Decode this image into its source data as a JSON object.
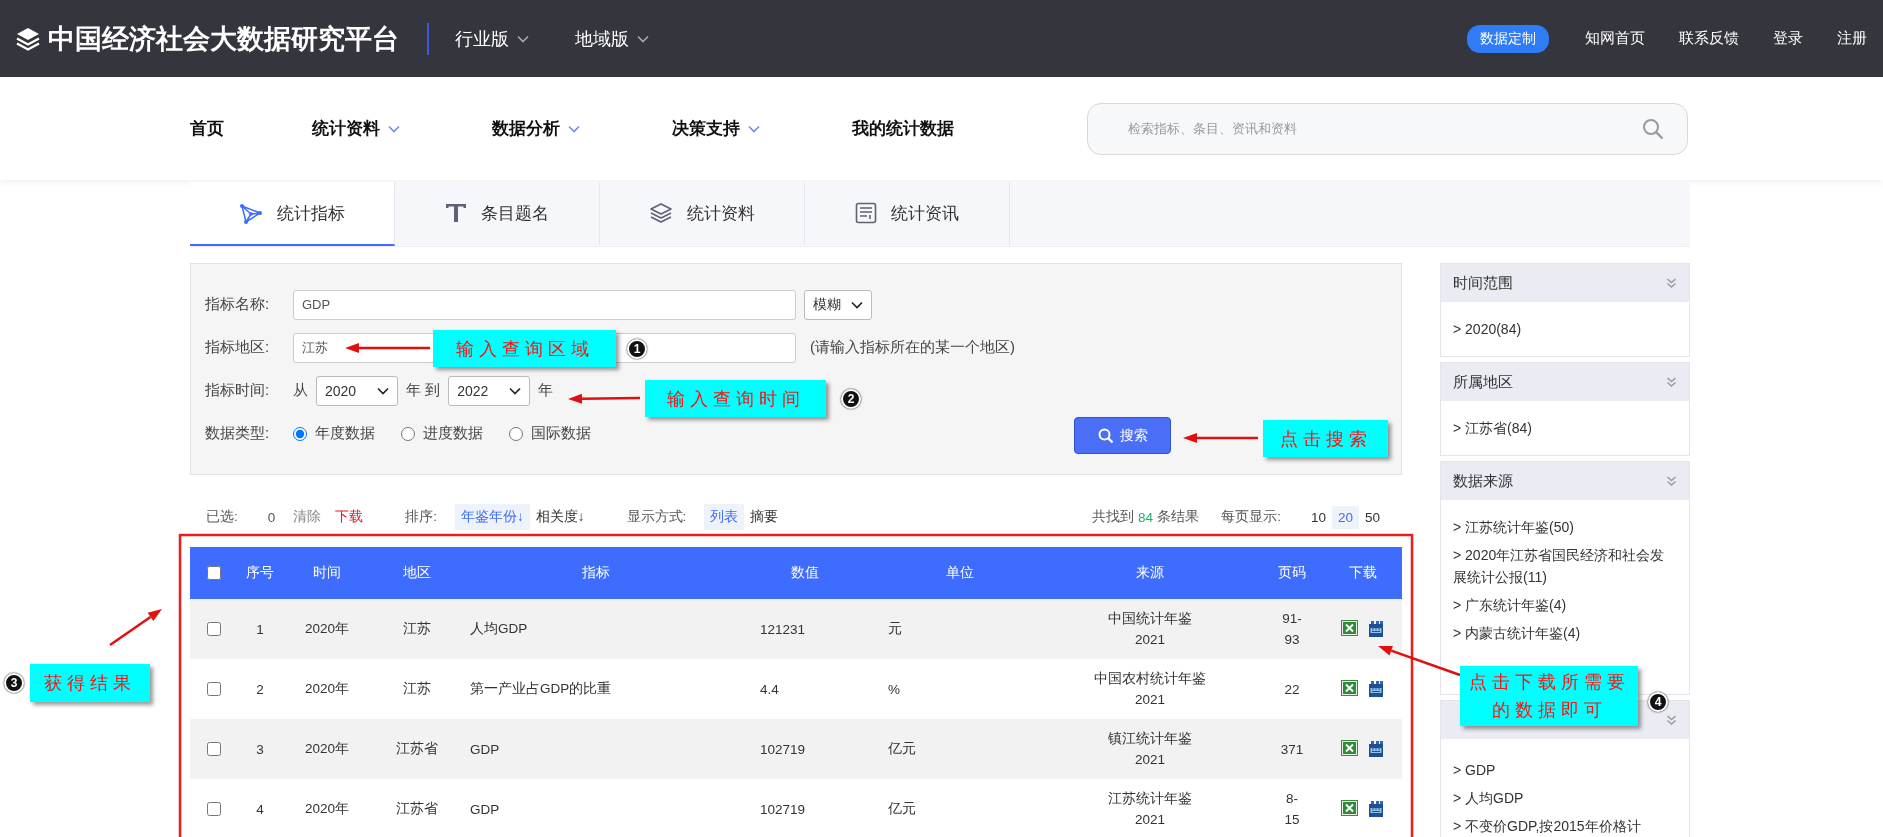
{
  "topbar": {
    "title": "中国经济社会大数据研究平台",
    "editions": [
      "行业版",
      "地域版"
    ],
    "custom_button": "数据定制",
    "links": [
      "知网首页",
      "联系反馈",
      "登录",
      "注册"
    ]
  },
  "nav": {
    "items": [
      {
        "label": "首页",
        "dropdown": false
      },
      {
        "label": "统计资料",
        "dropdown": true
      },
      {
        "label": "数据分析",
        "dropdown": true
      },
      {
        "label": "决策支持",
        "dropdown": true
      },
      {
        "label": "我的统计数据",
        "dropdown": false
      }
    ],
    "search_placeholder": "检索指标、条目、资讯和资料"
  },
  "tabs": [
    {
      "label": "统计指标",
      "kind": "network",
      "selected": true
    },
    {
      "label": "条目题名",
      "kind": "title",
      "selected": false
    },
    {
      "label": "统计资料",
      "kind": "layers",
      "selected": false
    },
    {
      "label": "统计资讯",
      "kind": "news",
      "selected": false
    }
  ],
  "form": {
    "name_label": "指标名称:",
    "name_value": "GDP",
    "match_mode": "模糊",
    "region_label": "指标地区:",
    "region_value": "江苏",
    "region_hint": "(请输入指标所在的某一个地区)",
    "time_label": "指标时间:",
    "from": "从",
    "from_year": "2020",
    "year_to": "年 到",
    "to_year": "2022",
    "year": "年",
    "type_label": "数据类型:",
    "types": [
      {
        "label": "年度数据",
        "selected": true
      },
      {
        "label": "进度数据",
        "selected": false
      },
      {
        "label": "国际数据",
        "selected": false
      }
    ],
    "search_button": "搜索"
  },
  "filter_bar": {
    "selected_label": "已选:",
    "selected_count": "0",
    "clear": "清除",
    "download": "下载",
    "sort_label": "排序:",
    "sort_options": [
      {
        "label": "年鉴年份↓",
        "selected": true
      },
      {
        "label": "相关度↓",
        "selected": false
      }
    ],
    "display_label": "显示方式:",
    "display_options": [
      {
        "label": "列表",
        "selected": true
      },
      {
        "label": "摘要",
        "selected": false
      }
    ],
    "found_prefix": "共找到",
    "found_count": "84",
    "found_suffix": "条结果",
    "per_page_label": "每页显示:",
    "per_page_options": [
      {
        "label": "10",
        "selected": false
      },
      {
        "label": "20",
        "selected": true
      },
      {
        "label": "50",
        "selected": false
      }
    ]
  },
  "table": {
    "header_checked": false,
    "columns": [
      "序号",
      "时间",
      "地区",
      "指标",
      "数值",
      "单位",
      "来源",
      "页码",
      "下载"
    ],
    "rows": [
      {
        "checked": false,
        "no": "1",
        "time": "2020年",
        "region": "江苏",
        "indicator": "人均GDP",
        "value": "121231",
        "unit": "元",
        "source": [
          "中国统计年鉴",
          "2021"
        ],
        "page": [
          "91-",
          "93"
        ]
      },
      {
        "checked": false,
        "no": "2",
        "time": "2020年",
        "region": "江苏",
        "indicator": "第一产业占GDP的比重",
        "value": "4.4",
        "unit": "%",
        "source": [
          "中国农村统计年鉴",
          "2021"
        ],
        "page": [
          "22"
        ]
      },
      {
        "checked": false,
        "no": "3",
        "time": "2020年",
        "region": "江苏省",
        "indicator": "GDP",
        "value": "102719",
        "unit": "亿元",
        "source": [
          "镇江统计年鉴",
          "2021"
        ],
        "page": [
          "371"
        ]
      },
      {
        "checked": false,
        "no": "4",
        "time": "2020年",
        "region": "江苏省",
        "indicator": "GDP",
        "value": "102719",
        "unit": "亿元",
        "source": [
          "江苏统计年鉴",
          "2021"
        ],
        "page": [
          "8-",
          "15"
        ]
      }
    ]
  },
  "sidebar": [
    {
      "title": "时间范围",
      "items": [
        "> 2020(84)"
      ]
    },
    {
      "title": "所属地区",
      "items": [
        "> 江苏省(84)"
      ]
    },
    {
      "title": "数据来源",
      "items": [
        "> 江苏统计年鉴(50)",
        "> 2020年江苏省国民经济和社会发展统计公报(11)",
        "> 广东统计年鉴(4)",
        "> 内蒙古统计年鉴(4)"
      ]
    },
    {
      "items": [
        "> GDP",
        "> 人均GDP",
        "> 不变价GDP,按2015年价格计"
      ]
    }
  ],
  "annotations": [
    {
      "text": "输入查询区域",
      "marker": "1"
    },
    {
      "text": "输入查询时间",
      "marker": "2"
    },
    {
      "text": "点击搜索"
    },
    {
      "text": "获得结果",
      "marker": "3"
    },
    {
      "text": "点击下载所需要的数据即可",
      "marker": "4"
    }
  ]
}
